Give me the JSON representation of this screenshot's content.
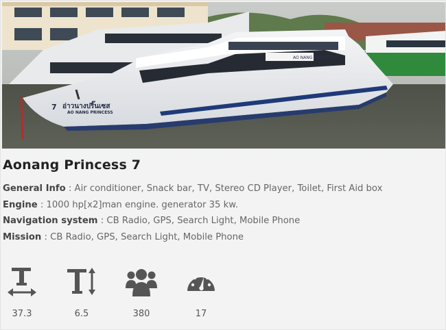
{
  "photo": {
    "boat_name_sign": "AO NANG PRINCESS 7",
    "hull_text_thai": "อ่าวนางปริ๊นเซส",
    "hull_text_en": "AO NANG PRINCESS",
    "hull_number": "7"
  },
  "boat": {
    "title": "Aonang Princess 7"
  },
  "specs": [
    {
      "label": "General Info",
      "value": " : Air conditioner, Snack bar, TV, Stereo CD Player, Toilet, First Aid box"
    },
    {
      "label": "Engine",
      "value": " : 1000 hp[x2]man engine. generator 35 kw."
    },
    {
      "label": "Navigation system",
      "value": " : CB Radio, GPS, Search Light, Mobile Phone"
    },
    {
      "label": "Mission",
      "value": " : CB Radio, GPS, Search Light, Mobile Phone"
    }
  ],
  "stats": [
    {
      "icon": "length-icon",
      "value": "37.3"
    },
    {
      "icon": "height-icon",
      "value": "6.5"
    },
    {
      "icon": "passengers-icon",
      "value": "380"
    },
    {
      "icon": "speed-gauge-icon",
      "value": "17"
    }
  ],
  "colors": {
    "icon": "#555555",
    "title": "#222222",
    "hull_stripe": "#1f3a78",
    "sea": "#55574e"
  }
}
